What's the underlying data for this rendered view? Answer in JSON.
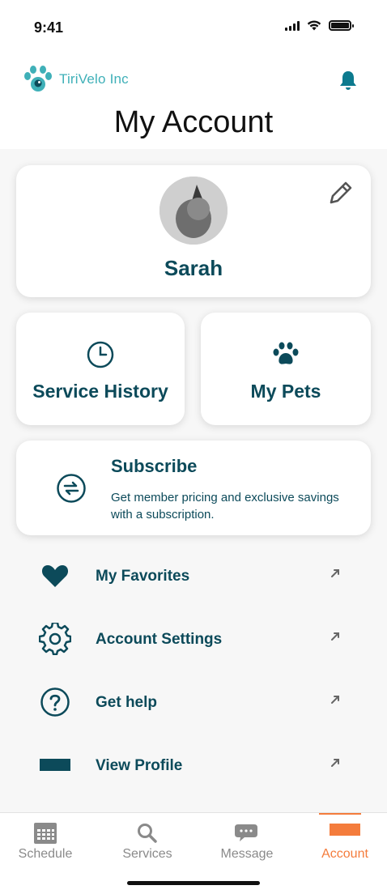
{
  "status_bar": {
    "time": "9:41"
  },
  "header": {
    "brand_name": "TiriVelo Inc",
    "title": "My Account"
  },
  "profile": {
    "name": "Sarah"
  },
  "tiles": {
    "service_history": "Service History",
    "my_pets": "My Pets"
  },
  "subscribe": {
    "title": "Subscribe",
    "description": "Get member pricing and exclusive savings with a subscription."
  },
  "menu": [
    {
      "label": "My Favorites",
      "icon": "heart-icon"
    },
    {
      "label": "Account Settings",
      "icon": "gear-icon"
    },
    {
      "label": "Get help",
      "icon": "question-icon"
    },
    {
      "label": "View Profile",
      "icon": "profile-icon"
    }
  ],
  "tabbar": [
    {
      "label": "Schedule",
      "icon": "calendar-icon"
    },
    {
      "label": "Services",
      "icon": "search-icon"
    },
    {
      "label": "Message",
      "icon": "chat-icon"
    },
    {
      "label": "Account",
      "icon": "account-icon",
      "active": true
    }
  ],
  "colors": {
    "primary": "#0c4a5a",
    "brand": "#3fb0b8",
    "active_tab": "#f47c3c",
    "inactive_tab": "#8a8a8a"
  }
}
